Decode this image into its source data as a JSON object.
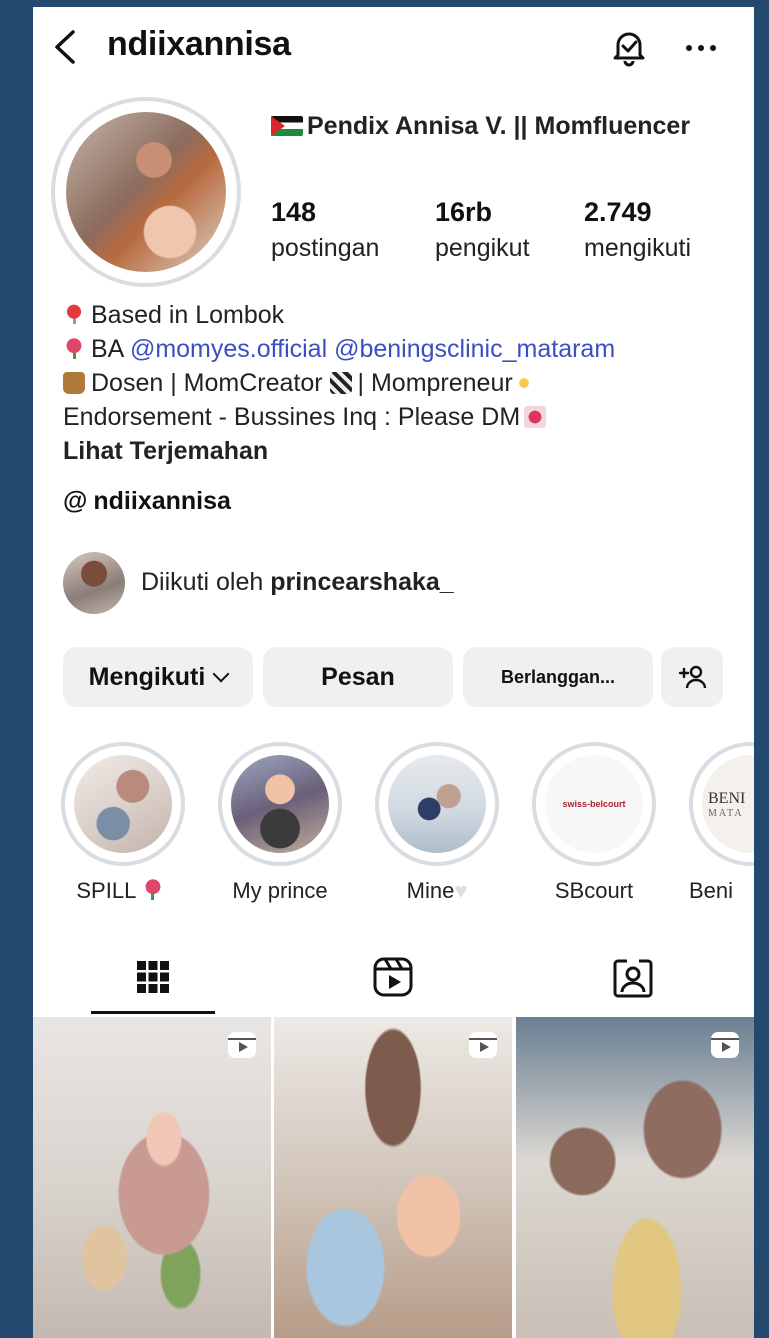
{
  "header": {
    "username": "ndiixannisa"
  },
  "profile": {
    "display_name": "Pendix Annisa V. || Momfluencer",
    "stats": [
      {
        "num": "148",
        "label": "postingan"
      },
      {
        "num": "16rb",
        "label": "pengikut"
      },
      {
        "num": "2.749",
        "label": "mengikuti"
      }
    ]
  },
  "bio": {
    "line1": "Based in Lombok",
    "line2_prefix": "BA",
    "line2_link1": "@momyes.official",
    "line2_link2": "@beningsclinic_mataram",
    "line3a": "Dosen | MomCreator",
    "line3b": "| Mompreneur",
    "line4": "Endorsement - Bussines Inq : Please DM",
    "translate": "Lihat Terjemahan"
  },
  "threads": {
    "handle": "ndiixannisa"
  },
  "followed_by": {
    "prefix": "Diikuti oleh",
    "user": "princearshaka_"
  },
  "actions": {
    "following": "Mengikuti",
    "message": "Pesan",
    "subscribe": "Berlanggan..."
  },
  "highlights": [
    {
      "label": "SPILL"
    },
    {
      "label": "My prince"
    },
    {
      "label": "Mine"
    },
    {
      "label": "SBcourt"
    },
    {
      "label": "Beni"
    }
  ],
  "highlight_thumb_text": {
    "sbcourt": "swiss-belcourt",
    "beni1": "BENI",
    "beni2": "MATA"
  }
}
